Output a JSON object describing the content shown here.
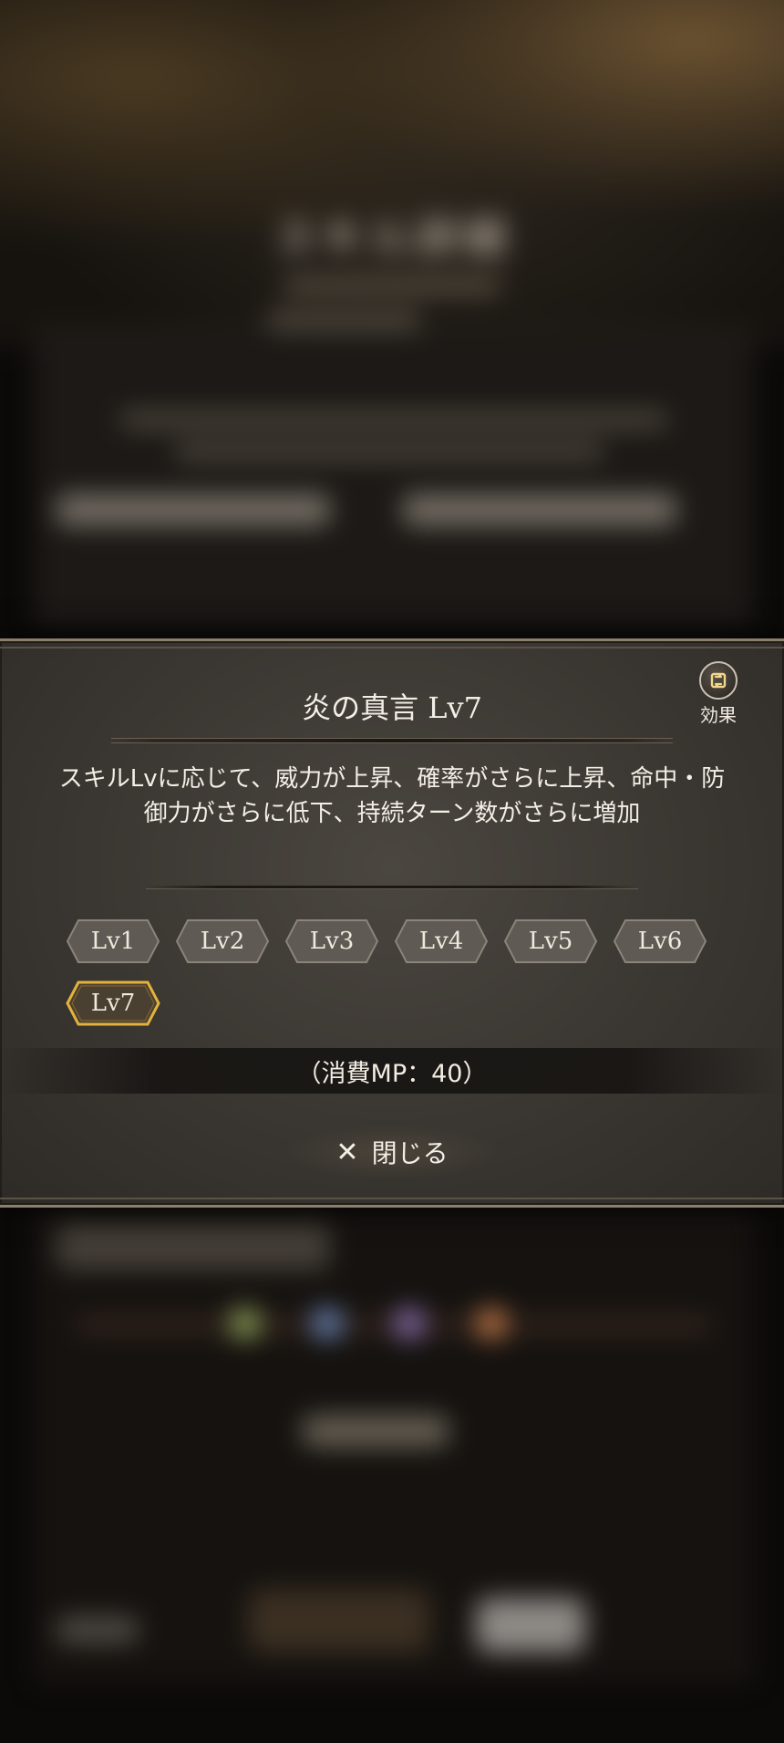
{
  "background": {
    "title": "スキル詳細"
  },
  "dialog": {
    "title": "炎の真言 Lv7",
    "effect_button_label": "効果",
    "description": "スキルLvに応じて、威力が上昇、確率がさらに上昇、命中・防御力がさらに低下、持続ターン数がさらに増加",
    "levels": [
      "Lv1",
      "Lv2",
      "Lv3",
      "Lv4",
      "Lv5",
      "Lv6",
      "Lv7"
    ],
    "selected_level": "Lv7",
    "mp_cost": "（消費MP：40）",
    "close_label": "閉じる"
  },
  "colors": {
    "selected_gold": "#e3b23c",
    "text": "#f4efe6",
    "badge_gray": "#5e5952"
  },
  "icons": {
    "effect": "swap-cycle-icon",
    "close": "close-x-icon"
  }
}
